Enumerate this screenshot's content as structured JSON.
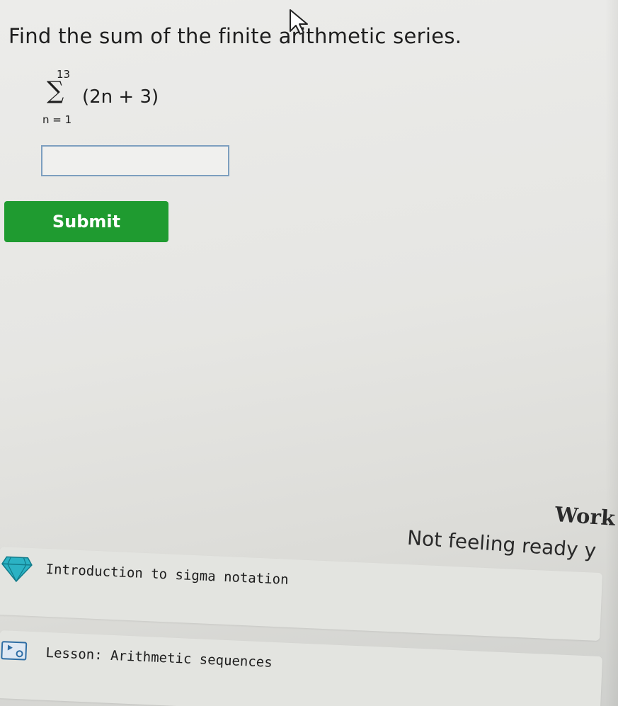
{
  "question": {
    "prompt": "Find the sum of the finite arithmetic series."
  },
  "series": {
    "upper_limit": "13",
    "sigma": "∑",
    "lower_limit": "n = 1",
    "expression": "(2n + 3)"
  },
  "answer": {
    "value": "",
    "placeholder": ""
  },
  "submit": {
    "label": "Submit",
    "color": "#1f9b30"
  },
  "work_panel": {
    "title": "Work",
    "subtitle": "Not feeling ready y"
  },
  "practice_links": [
    {
      "icon": "diamond-icon",
      "label": "Introduction to sigma notation"
    },
    {
      "icon": "lesson-icon",
      "label": "Lesson: Arithmetic sequences"
    }
  ]
}
